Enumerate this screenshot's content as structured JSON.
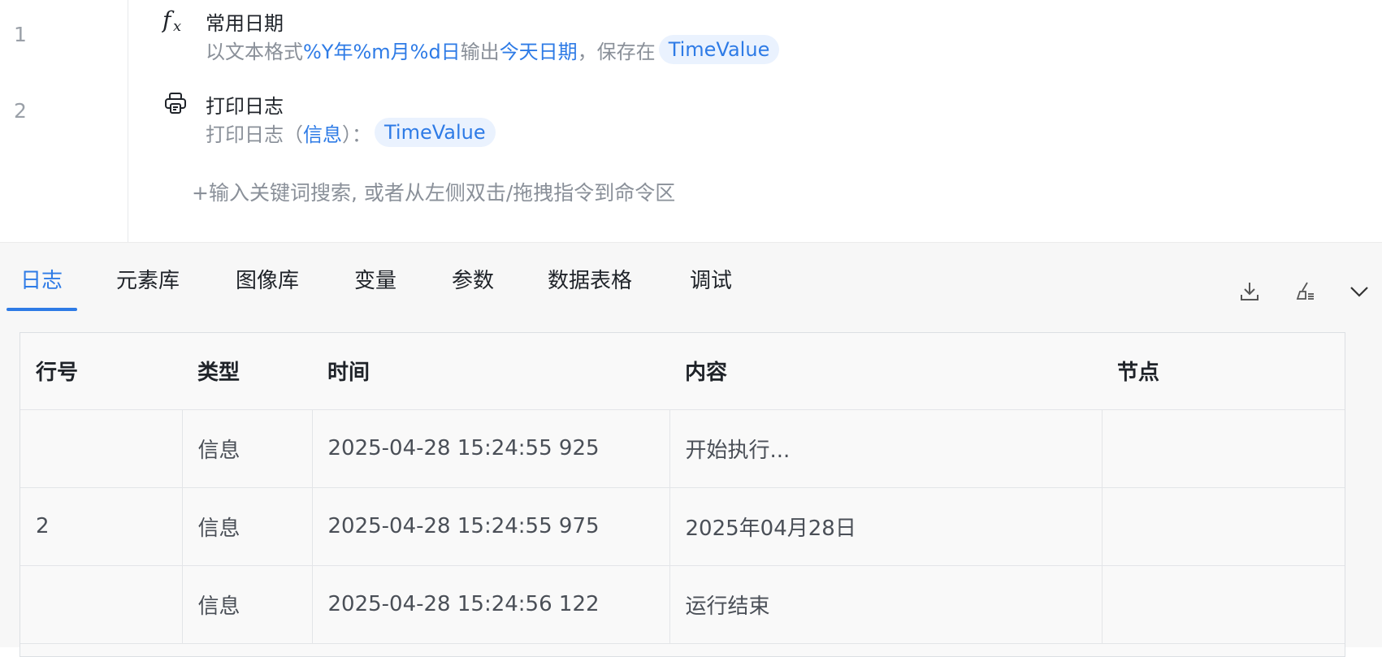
{
  "editor": {
    "lines": [
      {
        "number": "1",
        "icon": "fx-icon",
        "title": "常用日期",
        "desc_prefix": "以文本格式",
        "desc_format": "%Y年%m月%d日",
        "desc_mid": "输出",
        "desc_target": "今天日期",
        "desc_suffix": "，保存在",
        "variable": "TimeValue"
      },
      {
        "number": "2",
        "icon": "printer-icon",
        "title": "打印日志",
        "desc_prefix": "打印日志（",
        "desc_level": "信息",
        "desc_suffix": "）：",
        "variable": "TimeValue"
      }
    ],
    "add_hint": "+输入关键词搜索, 或者从左侧双击/拖拽指令到命令区"
  },
  "panel": {
    "tabs": [
      "日志",
      "元素库",
      "图像库",
      "变量",
      "参数",
      "数据表格",
      "调试"
    ],
    "active_tab": "日志",
    "tools": [
      "download-icon",
      "clear-log-icon",
      "chevron-down-icon"
    ]
  },
  "log_table": {
    "headers": [
      "行号",
      "类型",
      "时间",
      "内容",
      "节点"
    ],
    "rows": [
      [
        "",
        "信息",
        "2025-04-28 15:24:55 925",
        "开始执行...",
        ""
      ],
      [
        "2",
        "信息",
        "2025-04-28 15:24:55 975",
        "2025年04月28日",
        ""
      ],
      [
        "",
        "信息",
        "2025-04-28 15:24:56 122",
        "运行结束",
        ""
      ]
    ]
  },
  "colors": {
    "accent": "#2e7be6",
    "chip_bg": "#eaf2fe",
    "muted_text": "#8a9099",
    "panel_bg": "#f7f7f7"
  }
}
